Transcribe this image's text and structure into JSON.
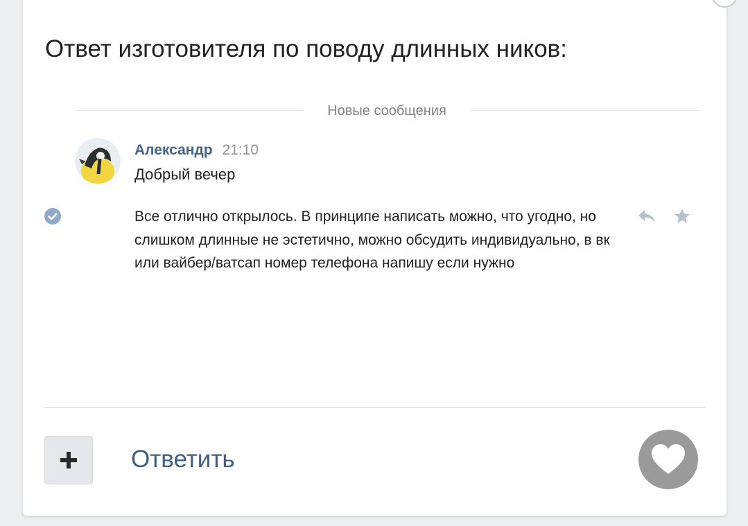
{
  "post": {
    "title": "Ответ изготовителя по поводу длинных ников:"
  },
  "chat": {
    "divider_label": "Новые сообщения",
    "message": {
      "author": "Александр",
      "time": "21:10",
      "text_1": "Добрый вечер",
      "text_2": "Все отлично открылось. В принципе написать можно, что угодно, но слишком длинные не эстетично, можно обсудить индивидуально, в вк или вайбер/ватсап номер телефона напишу если нужно"
    },
    "icons": [
      "avatar-bird",
      "read-check-icon",
      "reply-icon",
      "star-icon"
    ]
  },
  "footer": {
    "plus_icon": "plus-icon",
    "reply_label": "Ответить",
    "like_icon": "heart-icon"
  },
  "colors": {
    "author_name": "#42648b",
    "reply_link": "#3d5f85",
    "like_button_bg": "#9a9a9a",
    "check_blue": "#8fa9c9"
  }
}
